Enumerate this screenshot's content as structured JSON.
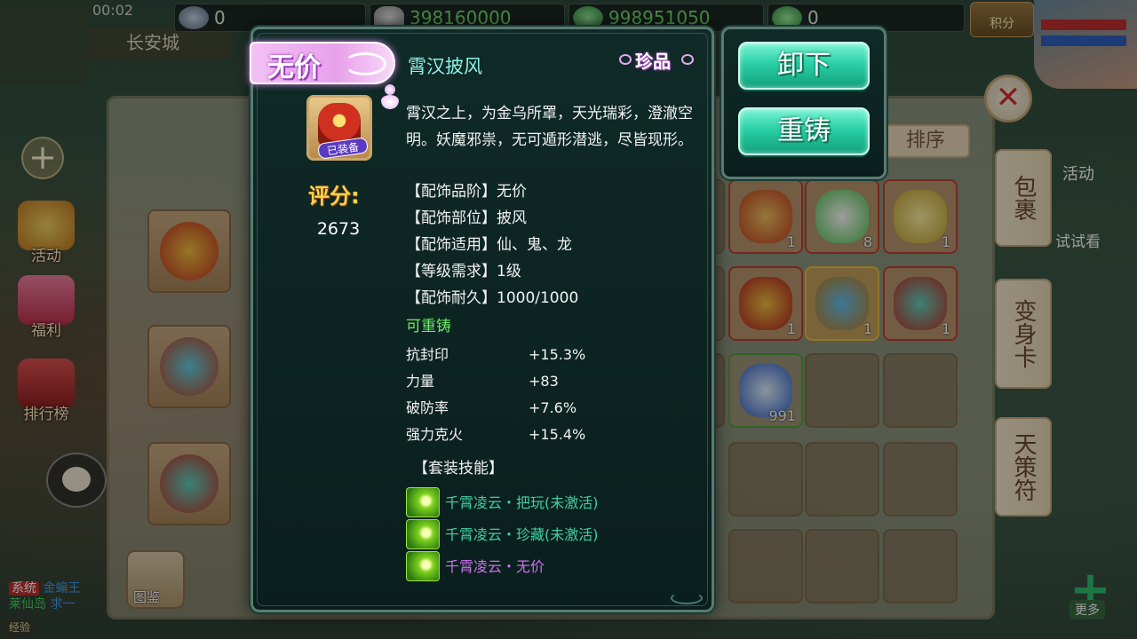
{
  "hud": {
    "time": "00:02",
    "location": "长安城",
    "currency_1": "0",
    "currency_2": "398160000",
    "currency_3": "998951050",
    "currency_4": "0",
    "points_label": "积分"
  },
  "left_menu": {
    "activity": "活动",
    "welfare": "福利",
    "ranking": "排行榜"
  },
  "chat": {
    "line1_tag": "系统",
    "line1_name": "金蝙王",
    "line2_a": "莱仙岛",
    "line2_b": "求一",
    "exp_label": "经验"
  },
  "inventory": {
    "sort_label": "排序",
    "tabs": [
      "包裹",
      "变身卡",
      "天策符"
    ],
    "right_activity": "活动",
    "right_trial": "试试看",
    "more_label": "更多",
    "atlas_label": "图鉴",
    "counts": [
      "1",
      "8",
      "1",
      "1",
      "1",
      "1",
      "991",
      "991"
    ]
  },
  "tooltip": {
    "rank": "无价",
    "name": "霄汉披风",
    "quality": "珍品",
    "equipped_tag": "已装备",
    "score_label": "评分:",
    "score_value": "2673",
    "description": "霄汉之上，为金乌所罩，天光瑞彩，澄澈空明。妖魔邪祟，无可遁形潜逃，尽皆现形。",
    "attributes": [
      "【配饰品阶】无价",
      "【配饰部位】披风",
      "【配饰适用】仙、鬼、龙",
      "【等级需求】1级",
      "【配饰耐久】1000/1000"
    ],
    "reforgeable": "可重铸",
    "stats": [
      {
        "name": "抗封印",
        "value": "+15.3%"
      },
      {
        "name": "力量",
        "value": "+83"
      },
      {
        "name": "破防率",
        "value": "+7.6%"
      },
      {
        "name": "强力克火",
        "value": "+15.4%"
      }
    ],
    "set_title": "【套装技能】",
    "set_skills": [
      {
        "text": "千霄凌云・把玩(未激活)",
        "color": "#3fd0a0"
      },
      {
        "text": "千霄凌云・珍藏(未激活)",
        "color": "#3fd0a0"
      },
      {
        "text": "千霄凌云・无价",
        "color": "#d070f0"
      }
    ]
  },
  "actions": {
    "unequip": "卸下",
    "reforge": "重铸"
  }
}
